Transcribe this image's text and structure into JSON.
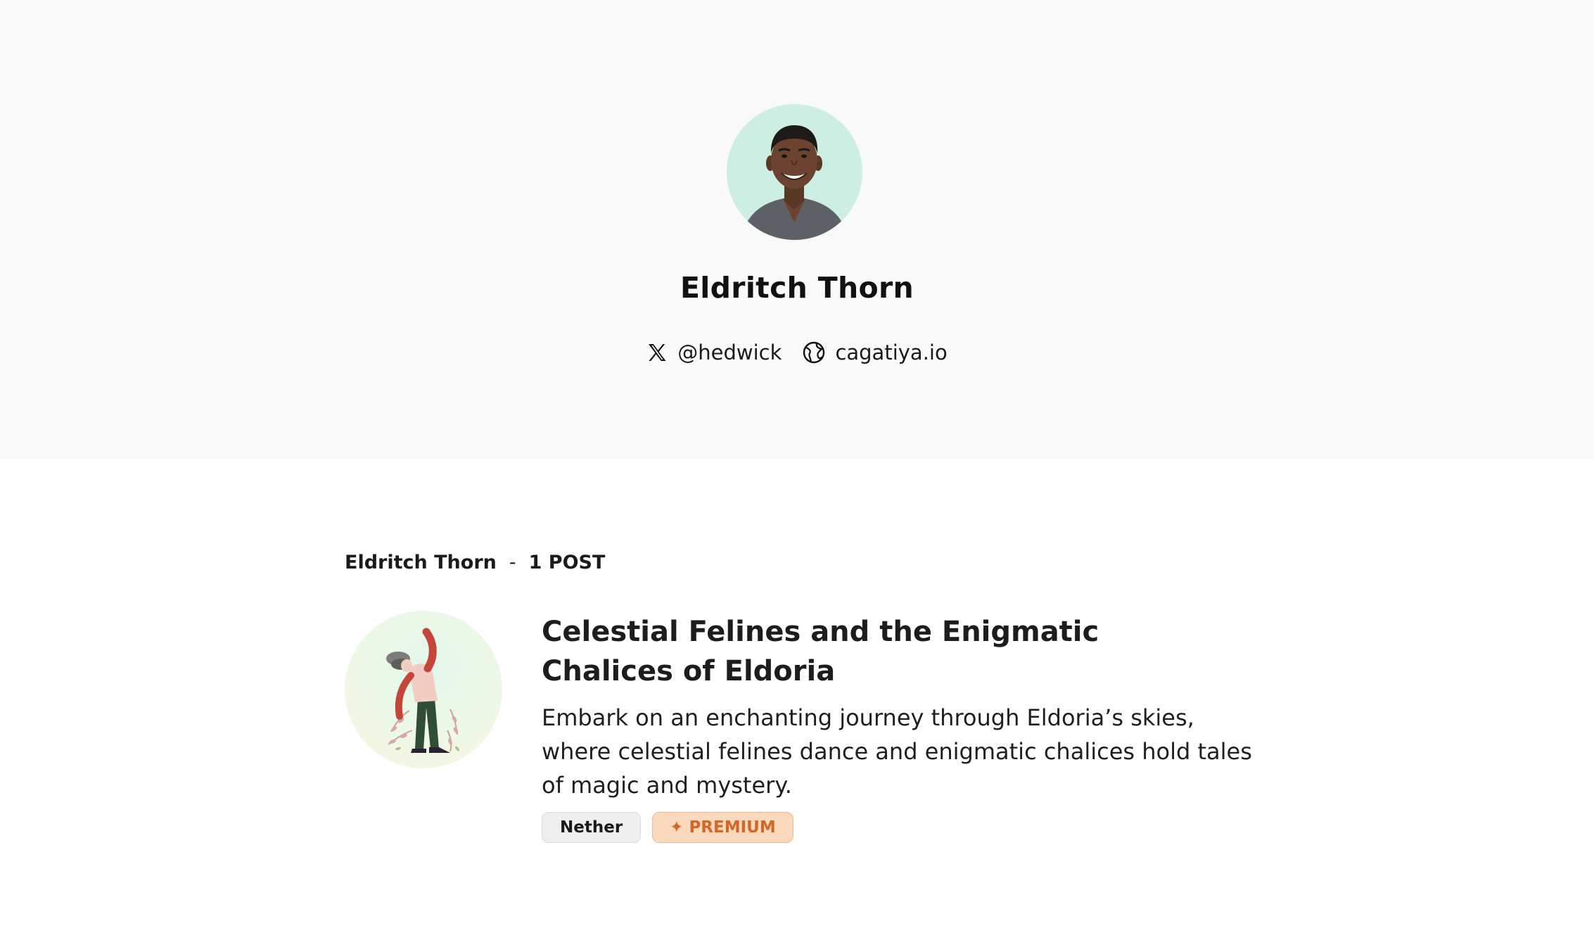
{
  "profile": {
    "name": "Eldritch Thorn",
    "avatar_icon": "person-avatar",
    "socials": [
      {
        "icon": "x-logo-icon",
        "label": "@hedwick"
      },
      {
        "icon": "globe-icon",
        "label": "cagatiya.io"
      }
    ]
  },
  "posts_section": {
    "author": "Eldritch Thorn",
    "separator": "-",
    "count_label": "1 POST"
  },
  "posts": [
    {
      "title": "Celestial Felines and the Enigmatic Chalices of Eldoria",
      "excerpt": "Embark on an enchanting journey through Eldoria’s skies, where celestial felines dance and enigmatic chalices hold tales of magic and mystery.",
      "tags": [
        {
          "label": "Nether",
          "style": "default"
        },
        {
          "label": "PREMIUM",
          "icon": "✦",
          "style": "premium"
        }
      ]
    }
  ],
  "colors": {
    "band_background": "#f9f9f9",
    "avatar_background": "#cdeee3",
    "premium_text": "#d4662a",
    "premium_background": "#fbd9bd"
  }
}
